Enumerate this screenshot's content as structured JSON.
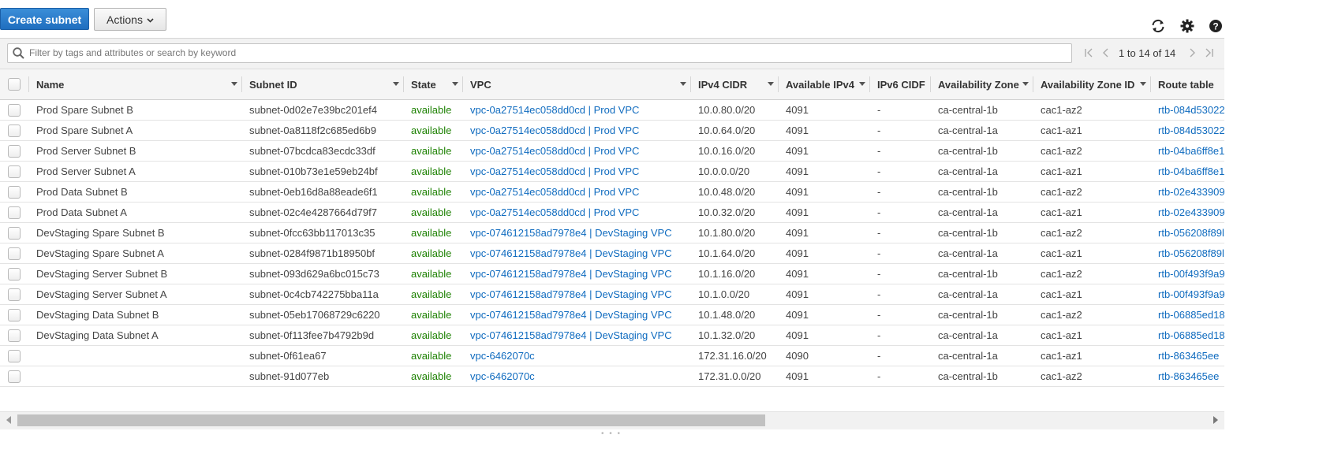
{
  "toolbar": {
    "create_label": "Create subnet",
    "actions_label": "Actions",
    "refresh_icon": "refresh-icon",
    "settings_icon": "gear-icon",
    "help_icon": "help-icon"
  },
  "filter": {
    "placeholder": "Filter by tags and attributes or search by keyword"
  },
  "pagination": {
    "range_text": "1 to 14 of 14"
  },
  "colors": {
    "primary": "#1f6ebf",
    "available": "#1d8102",
    "link": "#0f6bbf"
  },
  "columns": [
    "Name",
    "Subnet ID",
    "State",
    "VPC",
    "IPv4 CIDR",
    "Available IPv4",
    "IPv6 CIDF",
    "Availability Zone",
    "Availability Zone ID",
    "Route table"
  ],
  "rows": [
    {
      "name": "Prod Spare Subnet B",
      "subnet_id": "subnet-0d02e7e39bc201ef4",
      "state": "available",
      "vpc": "vpc-0a27514ec058dd0cd | Prod VPC",
      "ipv4": "10.0.80.0/20",
      "avail": "4091",
      "ipv6": "-",
      "az": "ca-central-1b",
      "az_id": "cac1-az2",
      "route": "rtb-084d53022"
    },
    {
      "name": "Prod Spare Subnet A",
      "subnet_id": "subnet-0a8118f2c685ed6b9",
      "state": "available",
      "vpc": "vpc-0a27514ec058dd0cd | Prod VPC",
      "ipv4": "10.0.64.0/20",
      "avail": "4091",
      "ipv6": "-",
      "az": "ca-central-1a",
      "az_id": "cac1-az1",
      "route": "rtb-084d53022"
    },
    {
      "name": "Prod Server Subnet B",
      "subnet_id": "subnet-07bcdca83ecdc33df",
      "state": "available",
      "vpc": "vpc-0a27514ec058dd0cd | Prod VPC",
      "ipv4": "10.0.16.0/20",
      "avail": "4091",
      "ipv6": "-",
      "az": "ca-central-1b",
      "az_id": "cac1-az2",
      "route": "rtb-04ba6ff8e1"
    },
    {
      "name": "Prod Server Subnet A",
      "subnet_id": "subnet-010b73e1e59eb24bf",
      "state": "available",
      "vpc": "vpc-0a27514ec058dd0cd | Prod VPC",
      "ipv4": "10.0.0.0/20",
      "avail": "4091",
      "ipv6": "-",
      "az": "ca-central-1a",
      "az_id": "cac1-az1",
      "route": "rtb-04ba6ff8e1"
    },
    {
      "name": "Prod Data Subnet B",
      "subnet_id": "subnet-0eb16d8a88eade6f1",
      "state": "available",
      "vpc": "vpc-0a27514ec058dd0cd | Prod VPC",
      "ipv4": "10.0.48.0/20",
      "avail": "4091",
      "ipv6": "-",
      "az": "ca-central-1b",
      "az_id": "cac1-az2",
      "route": "rtb-02e433909"
    },
    {
      "name": "Prod Data Subnet A",
      "subnet_id": "subnet-02c4e4287664d79f7",
      "state": "available",
      "vpc": "vpc-0a27514ec058dd0cd | Prod VPC",
      "ipv4": "10.0.32.0/20",
      "avail": "4091",
      "ipv6": "-",
      "az": "ca-central-1a",
      "az_id": "cac1-az1",
      "route": "rtb-02e433909"
    },
    {
      "name": "DevStaging Spare Subnet B",
      "subnet_id": "subnet-0fcc63bb117013c35",
      "state": "available",
      "vpc": "vpc-074612158ad7978e4 | DevStaging VPC",
      "ipv4": "10.1.80.0/20",
      "avail": "4091",
      "ipv6": "-",
      "az": "ca-central-1b",
      "az_id": "cac1-az2",
      "route": "rtb-056208f89l"
    },
    {
      "name": "DevStaging Spare Subnet A",
      "subnet_id": "subnet-0284f9871b18950bf",
      "state": "available",
      "vpc": "vpc-074612158ad7978e4 | DevStaging VPC",
      "ipv4": "10.1.64.0/20",
      "avail": "4091",
      "ipv6": "-",
      "az": "ca-central-1a",
      "az_id": "cac1-az1",
      "route": "rtb-056208f89l"
    },
    {
      "name": "DevStaging Server Subnet B",
      "subnet_id": "subnet-093d629a6bc015c73",
      "state": "available",
      "vpc": "vpc-074612158ad7978e4 | DevStaging VPC",
      "ipv4": "10.1.16.0/20",
      "avail": "4091",
      "ipv6": "-",
      "az": "ca-central-1b",
      "az_id": "cac1-az2",
      "route": "rtb-00f493f9a9"
    },
    {
      "name": "DevStaging Server Subnet A",
      "subnet_id": "subnet-0c4cb742275bba11a",
      "state": "available",
      "vpc": "vpc-074612158ad7978e4 | DevStaging VPC",
      "ipv4": "10.1.0.0/20",
      "avail": "4091",
      "ipv6": "-",
      "az": "ca-central-1a",
      "az_id": "cac1-az1",
      "route": "rtb-00f493f9a9"
    },
    {
      "name": "DevStaging Data Subnet B",
      "subnet_id": "subnet-05eb17068729c6220",
      "state": "available",
      "vpc": "vpc-074612158ad7978e4 | DevStaging VPC",
      "ipv4": "10.1.48.0/20",
      "avail": "4091",
      "ipv6": "-",
      "az": "ca-central-1b",
      "az_id": "cac1-az2",
      "route": "rtb-06885ed18"
    },
    {
      "name": "DevStaging Data Subnet A",
      "subnet_id": "subnet-0f113fee7b4792b9d",
      "state": "available",
      "vpc": "vpc-074612158ad7978e4 | DevStaging VPC",
      "ipv4": "10.1.32.0/20",
      "avail": "4091",
      "ipv6": "-",
      "az": "ca-central-1a",
      "az_id": "cac1-az1",
      "route": "rtb-06885ed18"
    },
    {
      "name": "",
      "subnet_id": "subnet-0f61ea67",
      "state": "available",
      "vpc": "vpc-6462070c",
      "ipv4": "172.31.16.0/20",
      "avail": "4090",
      "ipv6": "-",
      "az": "ca-central-1a",
      "az_id": "cac1-az1",
      "route": "rtb-863465ee"
    },
    {
      "name": "",
      "subnet_id": "subnet-91d077eb",
      "state": "available",
      "vpc": "vpc-6462070c",
      "ipv4": "172.31.0.0/20",
      "avail": "4091",
      "ipv6": "-",
      "az": "ca-central-1b",
      "az_id": "cac1-az2",
      "route": "rtb-863465ee"
    }
  ]
}
